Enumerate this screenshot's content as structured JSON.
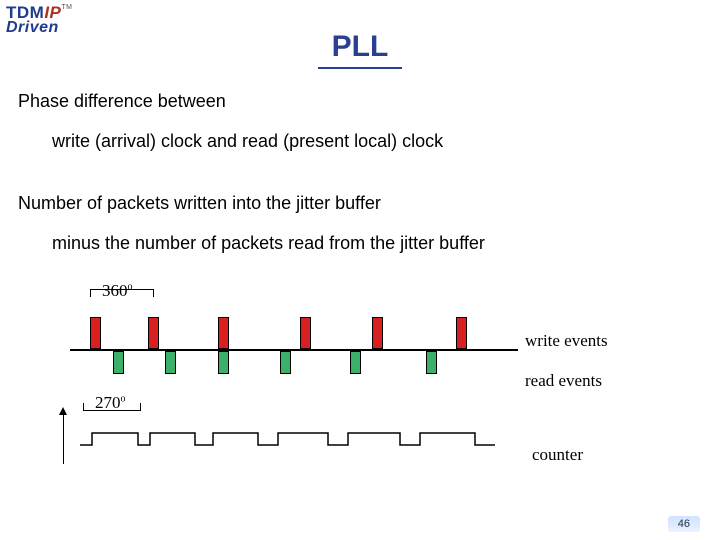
{
  "logo": {
    "part1": "TDM",
    "part2": "IP",
    "sub": "Driven",
    "tm": "TM"
  },
  "title": "PLL",
  "text": {
    "line1": "Phase difference between",
    "line2": "write (arrival) clock and read (present local) clock",
    "line3": "Number of packets written into the jitter buffer",
    "line4": "minus the number of packets read from the jitter buffer"
  },
  "diagram": {
    "deg360": "360",
    "deg360_unit": "o",
    "deg270": "270",
    "deg270_unit": "o",
    "write_label": "write events",
    "read_label": "read events",
    "counter_label": "counter",
    "write_positions": [
      20,
      78,
      148,
      230,
      302,
      386
    ],
    "read_positions": [
      13,
      65,
      118,
      180,
      250,
      326
    ]
  },
  "page_number": "46"
}
